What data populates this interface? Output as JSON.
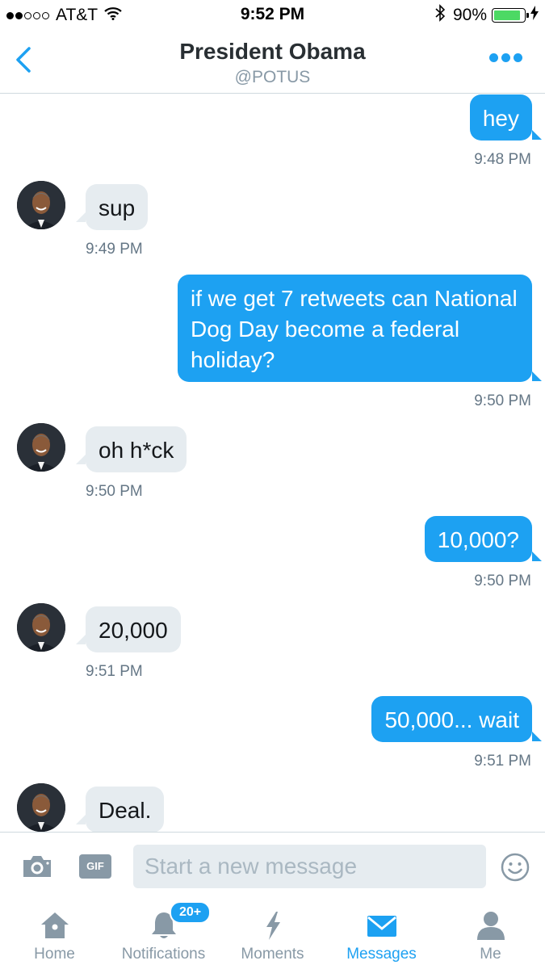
{
  "status_bar": {
    "carrier": "AT&T",
    "time": "9:52 PM",
    "battery": "90%",
    "battery_level": 0.9,
    "signal_bars_filled": 2,
    "signal_bars_total": 5
  },
  "header": {
    "title": "President Obama",
    "handle": "@POTUS"
  },
  "messages": [
    {
      "direction": "out",
      "text": "hey",
      "time": "9:48 PM"
    },
    {
      "direction": "in",
      "text": "sup",
      "time": "9:49 PM"
    },
    {
      "direction": "out",
      "text": "if we get 7 retweets can National Dog Day become a federal holiday?",
      "time": "9:50 PM"
    },
    {
      "direction": "in",
      "text": "oh h*ck",
      "time": "9:50 PM"
    },
    {
      "direction": "out",
      "text": "10,000?",
      "time": "9:50 PM"
    },
    {
      "direction": "in",
      "text": "20,000",
      "time": "9:51 PM"
    },
    {
      "direction": "out",
      "text": "50,000... wait",
      "time": "9:51 PM"
    },
    {
      "direction": "in",
      "text": "Deal.",
      "time": ""
    }
  ],
  "composer": {
    "gif_label": "GIF",
    "placeholder": "Start a new message"
  },
  "tabs": [
    {
      "label": "Home",
      "icon": "home-icon",
      "active": false
    },
    {
      "label": "Notifications",
      "icon": "bell-icon",
      "active": false,
      "badge": "20+"
    },
    {
      "label": "Moments",
      "icon": "lightning-icon",
      "active": false
    },
    {
      "label": "Messages",
      "icon": "envelope-icon",
      "active": true
    },
    {
      "label": "Me",
      "icon": "person-icon",
      "active": false
    }
  ],
  "colors": {
    "accent": "#1da1f2",
    "incoming_bubble": "#e6ecf0",
    "secondary_text": "#657786",
    "tab_inactive": "#8899a6"
  }
}
